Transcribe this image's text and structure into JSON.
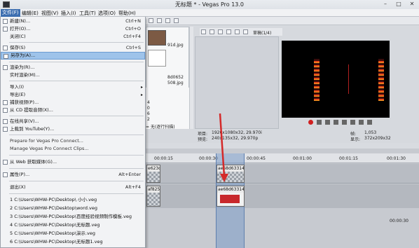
{
  "window": {
    "title": "无标题 * - Vegas Pro 13.0",
    "controls": {
      "minimize": "–",
      "restore": "□",
      "close": "✕"
    }
  },
  "menubar": {
    "items": [
      {
        "label": "文件(F)"
      },
      {
        "label": "编辑(E)"
      },
      {
        "label": "视图(V)"
      },
      {
        "label": "插入(I)"
      },
      {
        "label": "工具(T)"
      },
      {
        "label": "选项(O)"
      },
      {
        "label": "帮助(H)"
      }
    ]
  },
  "file_menu": {
    "items": [
      {
        "label": "新建(N)...",
        "shortcut": "Ctrl+N",
        "icon": "new-icon"
      },
      {
        "label": "打开(O)...",
        "shortcut": "Ctrl+O",
        "icon": "open-icon"
      },
      {
        "label": "关闭(C)",
        "shortcut": "Ctrl+F4"
      },
      {
        "label": "保存(S)",
        "shortcut": "Ctrl+S",
        "icon": "save-icon"
      },
      {
        "label": "另存为(A)...",
        "shortcut": "",
        "icon": "save-as-icon",
        "highlighted": true
      },
      {
        "label": "渲染为(R)...",
        "shortcut": "",
        "icon": "render-icon"
      },
      {
        "label": "实时渲染(M)...",
        "shortcut": ""
      },
      {
        "label": "导入(I)",
        "shortcut": "",
        "submenu": true
      },
      {
        "label": "导出(E)",
        "shortcut": "",
        "submenu": true
      },
      {
        "label": "捕获视频(P)...",
        "shortcut": "",
        "icon": "capture-icon"
      },
      {
        "label": "从 CD 提取音频(X)...",
        "shortcut": "",
        "icon": "cd-icon"
      },
      {
        "label": "在线共享(V)...",
        "shortcut": "",
        "icon": "share-icon"
      },
      {
        "label": "上载到 YouTube(Y)...",
        "shortcut": "",
        "icon": "youtube-icon"
      },
      {
        "label": "Prepare for Vegas Pro Connect...",
        "shortcut": ""
      },
      {
        "label": "Manage Vegas Pro Connect Clips...",
        "shortcut": ""
      },
      {
        "label": "从 Web 获取媒体(G)...",
        "shortcut": "",
        "icon": "web-icon"
      },
      {
        "label": "属性(P)...",
        "shortcut": "Alt+Enter",
        "icon": "properties-icon"
      },
      {
        "label": "退出(X)",
        "shortcut": "Alt+F4"
      },
      {
        "label": "1 C:\\Users\\WHW-PC\\Desktop\\ 小小.veg",
        "shortcut": ""
      },
      {
        "label": "2 C:\\Users\\WHW-PC\\Desktop\\word.veg",
        "shortcut": ""
      },
      {
        "label": "3 C:\\Users\\WHW-PC\\Desktop\\百度经验视频制作模板.veg",
        "shortcut": ""
      },
      {
        "label": "4 C:\\Users\\WHW-PC\\Desktop\\无标题.veg",
        "shortcut": ""
      },
      {
        "label": "5 C:\\Users\\WHW-PC\\Desktop\\演示.veg",
        "shortcut": ""
      },
      {
        "label": "6 C:\\Users\\WHW-PC\\Desktop\\无标题1.veg",
        "shortcut": ""
      }
    ]
  },
  "media_panel": {
    "file1": "91d.jpg",
    "file2a": "8d0652",
    "file2b": "508.jpg",
    "props": [
      "4",
      "0",
      "6",
      "2"
    ],
    "filter_label": "= 无(逐行扫描)"
  },
  "preview": {
    "quality_label": "草稿(1/4)",
    "project_label": "项目:",
    "project_value": "1920x1080x32, 29.970i",
    "preview_label": "预览:",
    "preview_value": "240x135x32, 29.970p",
    "frame_label": "帧:",
    "frame_value": "1,053",
    "display_label": "显示:",
    "display_value": "372x209x32"
  },
  "timeline": {
    "time_marks": [
      "00:00:15",
      "00:00:30",
      "00:00:45",
      "00:01:00",
      "00:01:15",
      "00:01:30"
    ],
    "cursor_time": "00:00:30",
    "clips": [
      {
        "name": "e623c"
      },
      {
        "name": "ae68d63314"
      },
      {
        "name": "af825"
      },
      {
        "name": "ae68d63314"
      }
    ]
  }
}
